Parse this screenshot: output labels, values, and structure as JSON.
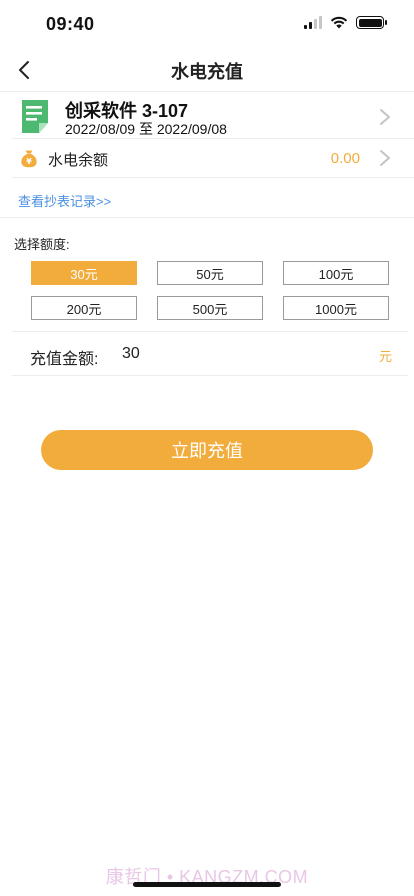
{
  "status_bar": {
    "time": "09:40"
  },
  "nav": {
    "title": "水电充值"
  },
  "room": {
    "name": "创采软件 3-107",
    "date_range": "2022/08/09 至 2022/09/08"
  },
  "balance": {
    "label": "水电余额",
    "value": "0.00"
  },
  "meter_link": {
    "label": "查看抄表记录>>"
  },
  "amount_select": {
    "label": "选择额度:",
    "options": [
      "30元",
      "50元",
      "100元",
      "200元",
      "500元",
      "1000元"
    ],
    "selected_index": 0
  },
  "recharge": {
    "label": "充值金额:",
    "value": "30",
    "unit": "元"
  },
  "submit": {
    "label": "立即充值"
  },
  "watermark": "康哲门 • KANGZM.COM",
  "colors": {
    "accent": "#f2ac3b",
    "link": "#4a90e2",
    "icon_green": "#4cb870"
  }
}
